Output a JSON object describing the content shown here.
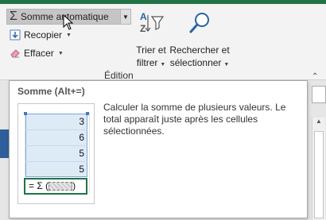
{
  "ribbon": {
    "autosum": {
      "label": "Somme automatique",
      "icon": "sigma-icon",
      "dropdown": "chevron-down-icon"
    },
    "fill": {
      "label": "Recopier",
      "icon": "fill-down-icon"
    },
    "clear": {
      "label": "Effacer",
      "icon": "eraser-icon"
    },
    "sort_filter": {
      "line1": "Trier et",
      "line2": "filtrer",
      "icon": "sort-filter-icon"
    },
    "find_select": {
      "line1": "Rechercher et",
      "line2": "sélectionner",
      "icon": "magnifier-icon"
    },
    "group_label": "Édition",
    "accent": "#217346"
  },
  "tooltip": {
    "title": "Somme (Alt+=)",
    "description": "Calculer la somme de plusieurs valeurs. Le total apparaît juste après les cellules sélectionnées.",
    "example": {
      "values": [
        "3",
        "6",
        "5",
        "5"
      ],
      "formula_prefix": "= Σ (",
      "formula_suffix": ")"
    }
  },
  "icons": {
    "chevron": "⌄",
    "sigma": "Σ",
    "collapse": "^"
  }
}
